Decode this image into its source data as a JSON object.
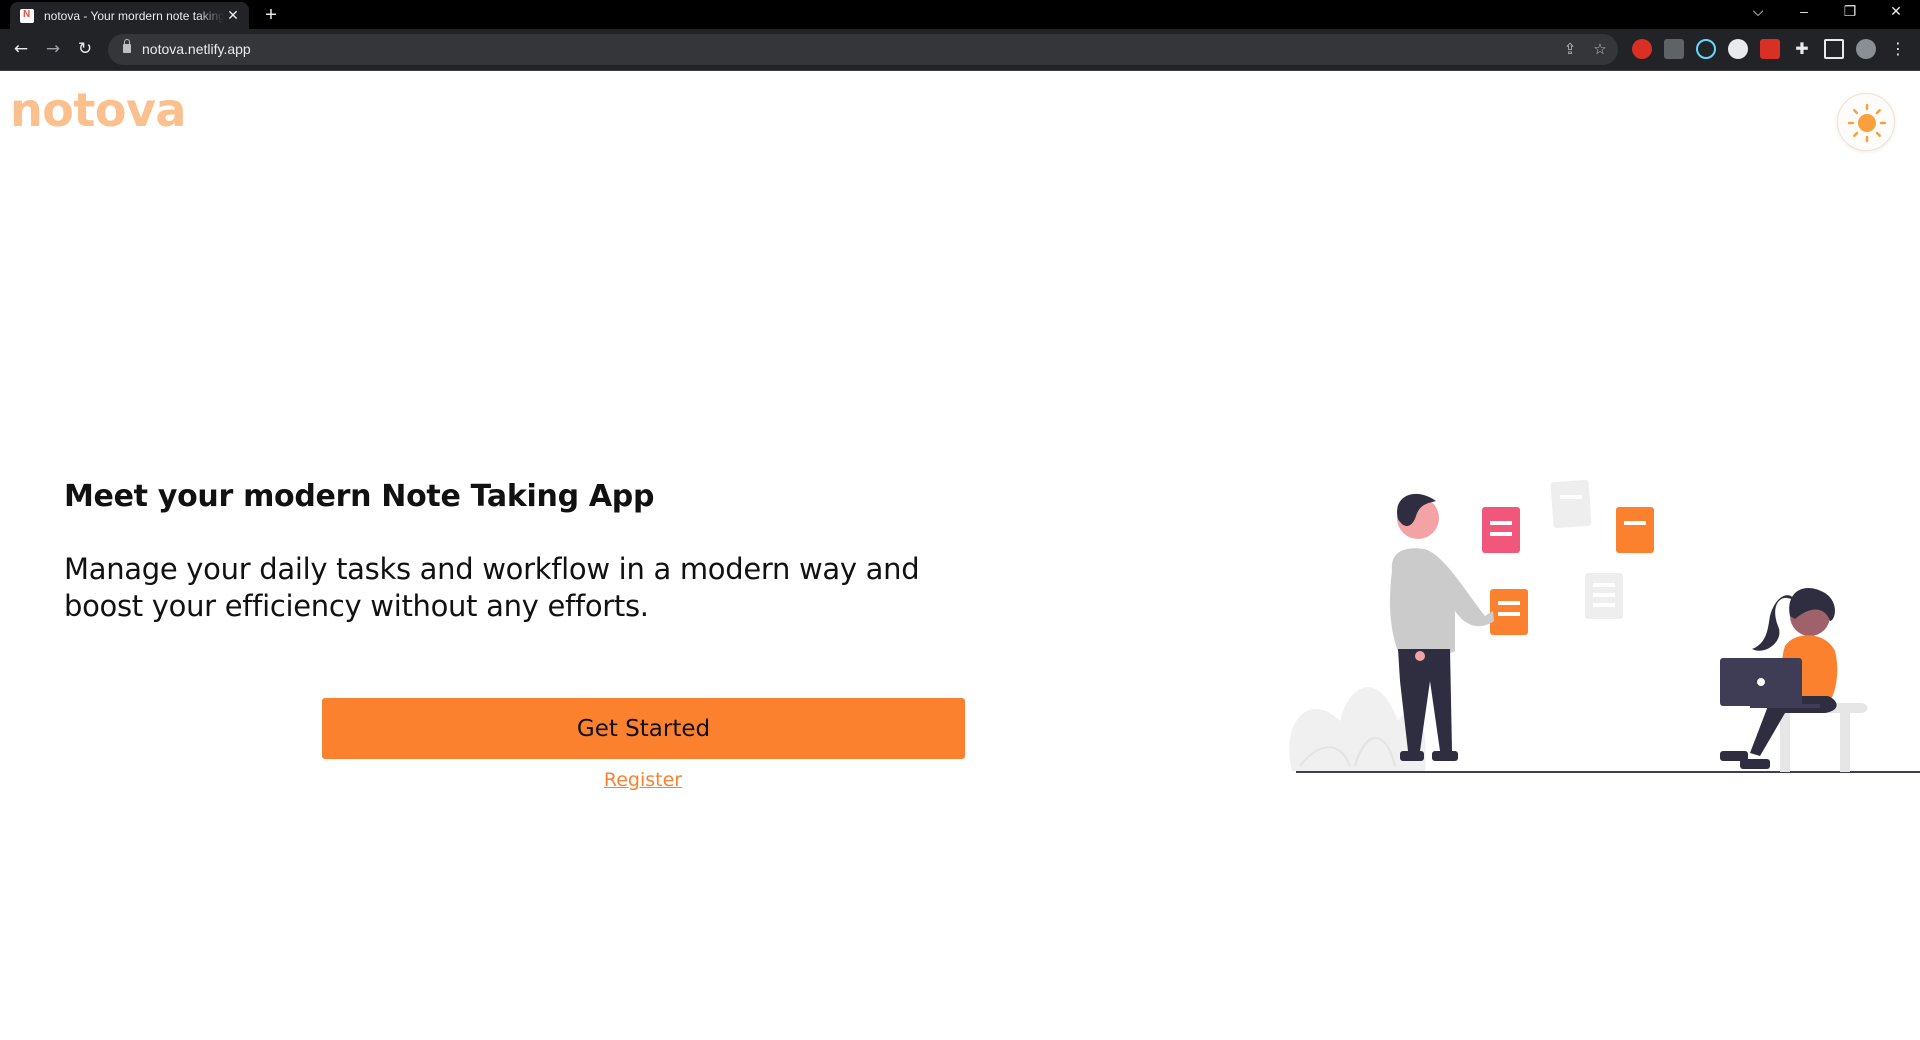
{
  "browser": {
    "tab_title": "notova - Your mordern note taking app",
    "tab_close": "✕",
    "new_tab": "+",
    "url": "notova.netlify.app",
    "window_controls": {
      "list": "⌵",
      "minimize": "–",
      "restore": "❐",
      "close": "✕"
    },
    "nav": {
      "back": "←",
      "forward": "→",
      "reload": "↻"
    }
  },
  "site": {
    "logo": "notova",
    "brand_color": "#fb812e",
    "logo_color": "#fcbf8e",
    "theme_toggle_icon": "sun-icon"
  },
  "hero": {
    "headline": "Meet your modern Note Taking App",
    "subtext": "Manage your daily tasks and workflow in a modern way and boost your efficiency without any efforts.",
    "cta_label": "Get Started",
    "register_label": "Register"
  },
  "illustration": {
    "accent_pink": "#f0577a",
    "accent_orange": "#fb812e",
    "dark": "#2f2e41"
  }
}
